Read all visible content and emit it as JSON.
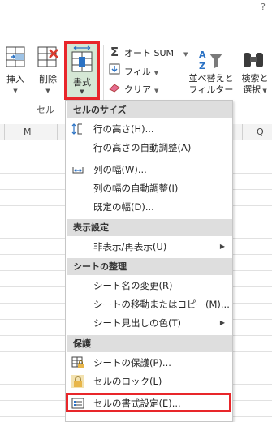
{
  "ribbon": {
    "help": "?",
    "insert_label": "挿入",
    "delete_label": "削除",
    "format_label": "書式",
    "group_cells_label": "セル",
    "autosum_label": "オート SUM",
    "fill_label": "フィル",
    "clear_label": "クリア",
    "sort_line1": "並べ替えと",
    "sort_line2": "フィルター",
    "find_line1": "検索と",
    "find_line2": "選択"
  },
  "columns": {
    "m": "M",
    "q": "Q"
  },
  "menu": {
    "section_cell_size": "セルのサイズ",
    "row_height": "行の高さ(H)...",
    "autofit_row": "行の高さの自動調整(A)",
    "col_width": "列の幅(W)...",
    "autofit_col": "列の幅の自動調整(I)",
    "default_width": "既定の幅(D)...",
    "section_visibility": "表示設定",
    "hide_unhide": "非表示/再表示(U)",
    "section_organize": "シートの整理",
    "rename_sheet": "シート名の変更(R)",
    "move_copy": "シートの移動またはコピー(M)...",
    "tab_color": "シート見出しの色(T)",
    "section_protection": "保護",
    "protect_sheet": "シートの保護(P)...",
    "lock_cell": "セルのロック(L)",
    "format_cells": "セルの書式設定(E)..."
  },
  "colors": {
    "highlight": "#e8262a",
    "format_bg": "#d5e7d5",
    "section_bg": "#dedede"
  }
}
